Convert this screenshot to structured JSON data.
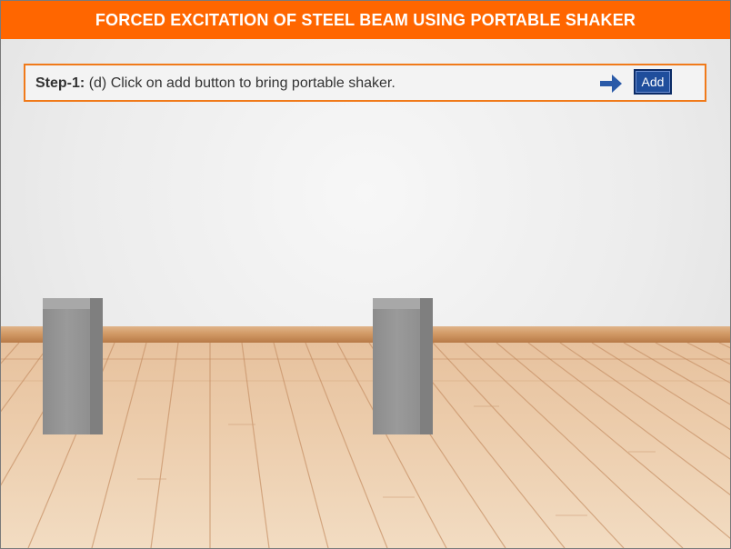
{
  "header": {
    "title": "FORCED EXCITATION OF STEEL BEAM USING PORTABLE SHAKER"
  },
  "step": {
    "label": "Step-1:",
    "instruction": "(d) Click on add button to bring portable shaker."
  },
  "controls": {
    "add_label": "Add"
  },
  "icons": {
    "pointer": "arrow-right-icon"
  },
  "colors": {
    "header_bg": "#ff6600",
    "step_border": "#f07a1a",
    "button_bg": "#1f4e9c",
    "arrow": "#2a5aa8"
  }
}
